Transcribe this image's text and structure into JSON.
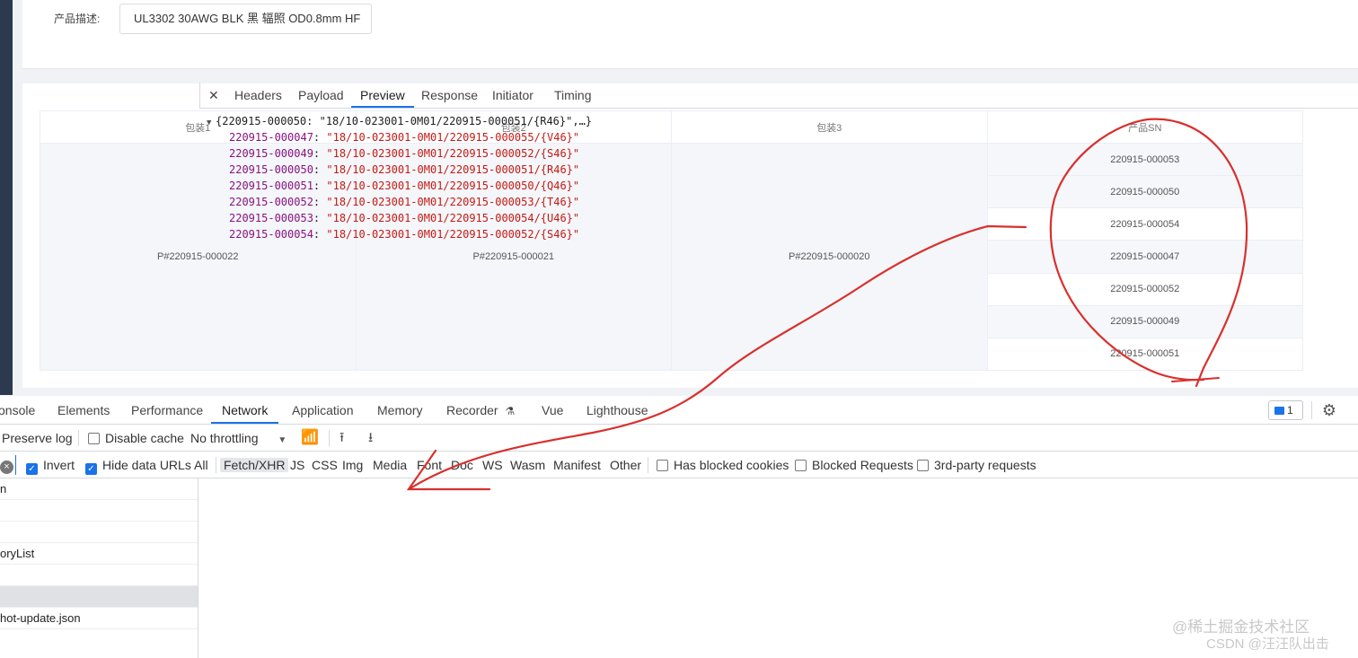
{
  "form": {
    "label": "产品描述:",
    "value": "UL3302 30AWG BLK 黑 辐照 OD0.8mm HF"
  },
  "table": {
    "headers": [
      "包装1",
      "包装2",
      "包装3",
      "产品SN"
    ],
    "merged": [
      "P#220915-000022",
      "P#220915-000021",
      "P#220915-000020"
    ],
    "sn_rows": [
      "220915-000053",
      "220915-000050",
      "220915-000054",
      "220915-000047",
      "220915-000052",
      "220915-000049",
      "220915-000051"
    ]
  },
  "devtools": {
    "tabs": [
      "onsole",
      "Elements",
      "Performance",
      "Network",
      "Application",
      "Memory",
      "Recorder",
      "Vue",
      "Lighthouse"
    ],
    "active_tab": "Network",
    "recorder_icon": "flask-icon",
    "issues_count": "1",
    "toolbar": {
      "preserve_log": "Preserve log",
      "disable_cache": "Disable cache",
      "throttling": "No throttling"
    },
    "filters": {
      "invert": "Invert",
      "hide_data_urls": "Hide data URLs",
      "types": [
        "All",
        "Fetch/XHR",
        "JS",
        "CSS",
        "Img",
        "Media",
        "Font",
        "Doc",
        "WS",
        "Wasm",
        "Manifest",
        "Other"
      ],
      "active_type": "Fetch/XHR",
      "has_blocked_cookies": "Has blocked cookies",
      "blocked_requests": "Blocked Requests",
      "third_party": "3rd-party requests"
    },
    "requests": [
      "n",
      "",
      "",
      "oryList",
      "",
      "",
      "hot-update.json"
    ],
    "detail_tabs": [
      "Headers",
      "Payload",
      "Preview",
      "Response",
      "Initiator",
      "Timing"
    ],
    "active_detail_tab": "Preview",
    "preview": {
      "summary": "{220915-000050: \"18/10-023001-0M01/220915-000051/{R46}\",…}",
      "entries": [
        {
          "key": "220915-000047",
          "value": "\"18/10-023001-0M01/220915-000055/{V46}\""
        },
        {
          "key": "220915-000049",
          "value": "\"18/10-023001-0M01/220915-000052/{S46}\""
        },
        {
          "key": "220915-000050",
          "value": "\"18/10-023001-0M01/220915-000051/{R46}\""
        },
        {
          "key": "220915-000051",
          "value": "\"18/10-023001-0M01/220915-000050/{Q46}\""
        },
        {
          "key": "220915-000052",
          "value": "\"18/10-023001-0M01/220915-000053/{T46}\""
        },
        {
          "key": "220915-000053",
          "value": "\"18/10-023001-0M01/220915-000054/{U46}\""
        },
        {
          "key": "220915-000054",
          "value": "\"18/10-023001-0M01/220915-000052/{S46}\""
        }
      ]
    }
  },
  "watermark": {
    "line1": "@稀土掘金技术社区",
    "line2": "CSDN @汪汪队出击"
  },
  "annotation_color": "#d9302c"
}
